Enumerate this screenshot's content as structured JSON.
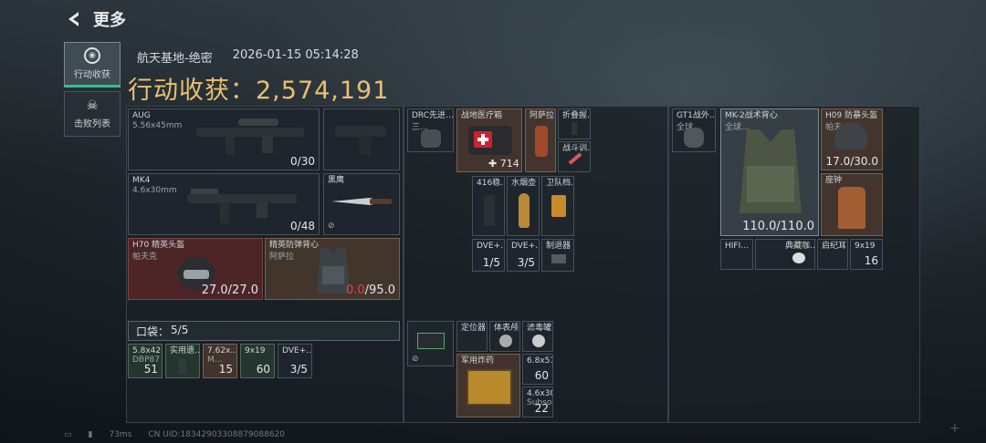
{
  "header": {
    "back_label": "更多"
  },
  "side_tabs": [
    {
      "label": "行动收获",
      "icon": "target-icon",
      "active": true
    },
    {
      "label": "击败列表",
      "icon": "skull-icon",
      "active": false
    }
  ],
  "meta": {
    "map": "航天基地-绝密",
    "datetime": "2026-01-15 05:14:28"
  },
  "summary": {
    "label": "行动收获：",
    "value": "2,574,191"
  },
  "weapons": [
    {
      "name": "AUG",
      "ammo": "5.56x45mm",
      "count": "0/30"
    },
    {
      "name": "MK4",
      "ammo": "4.6x30mm",
      "count": "0/48"
    },
    {
      "name": "黑鹰"
    }
  ],
  "helmet": {
    "name": "H70 精英头盔",
    "sub": "帕夫克",
    "durability": "27.0/27.0"
  },
  "vest": {
    "name": "精英防弹背心",
    "sub": "阿萨拉",
    "dur_current": "0.0",
    "dur_total": "/95.0"
  },
  "pocket": {
    "label": "口袋：",
    "value": "5/5"
  },
  "pocket_items": [
    {
      "name": "5.8x42",
      "sub": "DBP87",
      "count": "51"
    },
    {
      "name": "实用遗…",
      "sub": "",
      "count": ""
    },
    {
      "name": "7.62x…",
      "sub": "M…",
      "count": "15"
    },
    {
      "name": "9x19",
      "sub": "",
      "count": "60"
    },
    {
      "name": "DVE+…",
      "sub": "",
      "count": "3/5"
    }
  ],
  "bag1": {
    "items": [
      {
        "name": "DRC先进…",
        "sub": "三…"
      },
      {
        "name": "战地医疗箱",
        "count": "714"
      },
      {
        "name": "阿萨拉…"
      },
      {
        "name": "折叠握…"
      },
      {
        "name": "战斗训…"
      },
      {
        "name": "416稳…"
      },
      {
        "name": "水烟壶"
      },
      {
        "name": "卫队档…"
      },
      {
        "name": "DVE+…",
        "count": "1/5"
      },
      {
        "name": "DVE+…",
        "count": "3/5"
      },
      {
        "name": "制退器"
      }
    ]
  },
  "bag2": {
    "items": [
      {
        "name": "定位器"
      },
      {
        "name": "体表颅…"
      },
      {
        "name": "滤毒罐"
      },
      {
        "name": "军用炸药"
      },
      {
        "name": "6.8x51",
        "count": "60"
      },
      {
        "name": "4.6x30",
        "sub": "Subson…",
        "count": "22"
      }
    ]
  },
  "gear": {
    "items": [
      {
        "name": "GT1战外…",
        "sub": "全球…"
      },
      {
        "name": "MK-2战术背心",
        "sub": "全球…",
        "durability": "110.0/110.0"
      },
      {
        "name": "H09 防暴头盔",
        "sub": "帕夫…",
        "durability": "17.0/30.0"
      },
      {
        "name": "座钟"
      },
      {
        "name": "HIFI…"
      },
      {
        "name": "典藏咖…"
      },
      {
        "name": "启纪耳…"
      },
      {
        "name": "9x19",
        "count": "16"
      }
    ]
  },
  "footer": {
    "ping": "73ms",
    "uid": "CN UID:18342903308879088620"
  }
}
